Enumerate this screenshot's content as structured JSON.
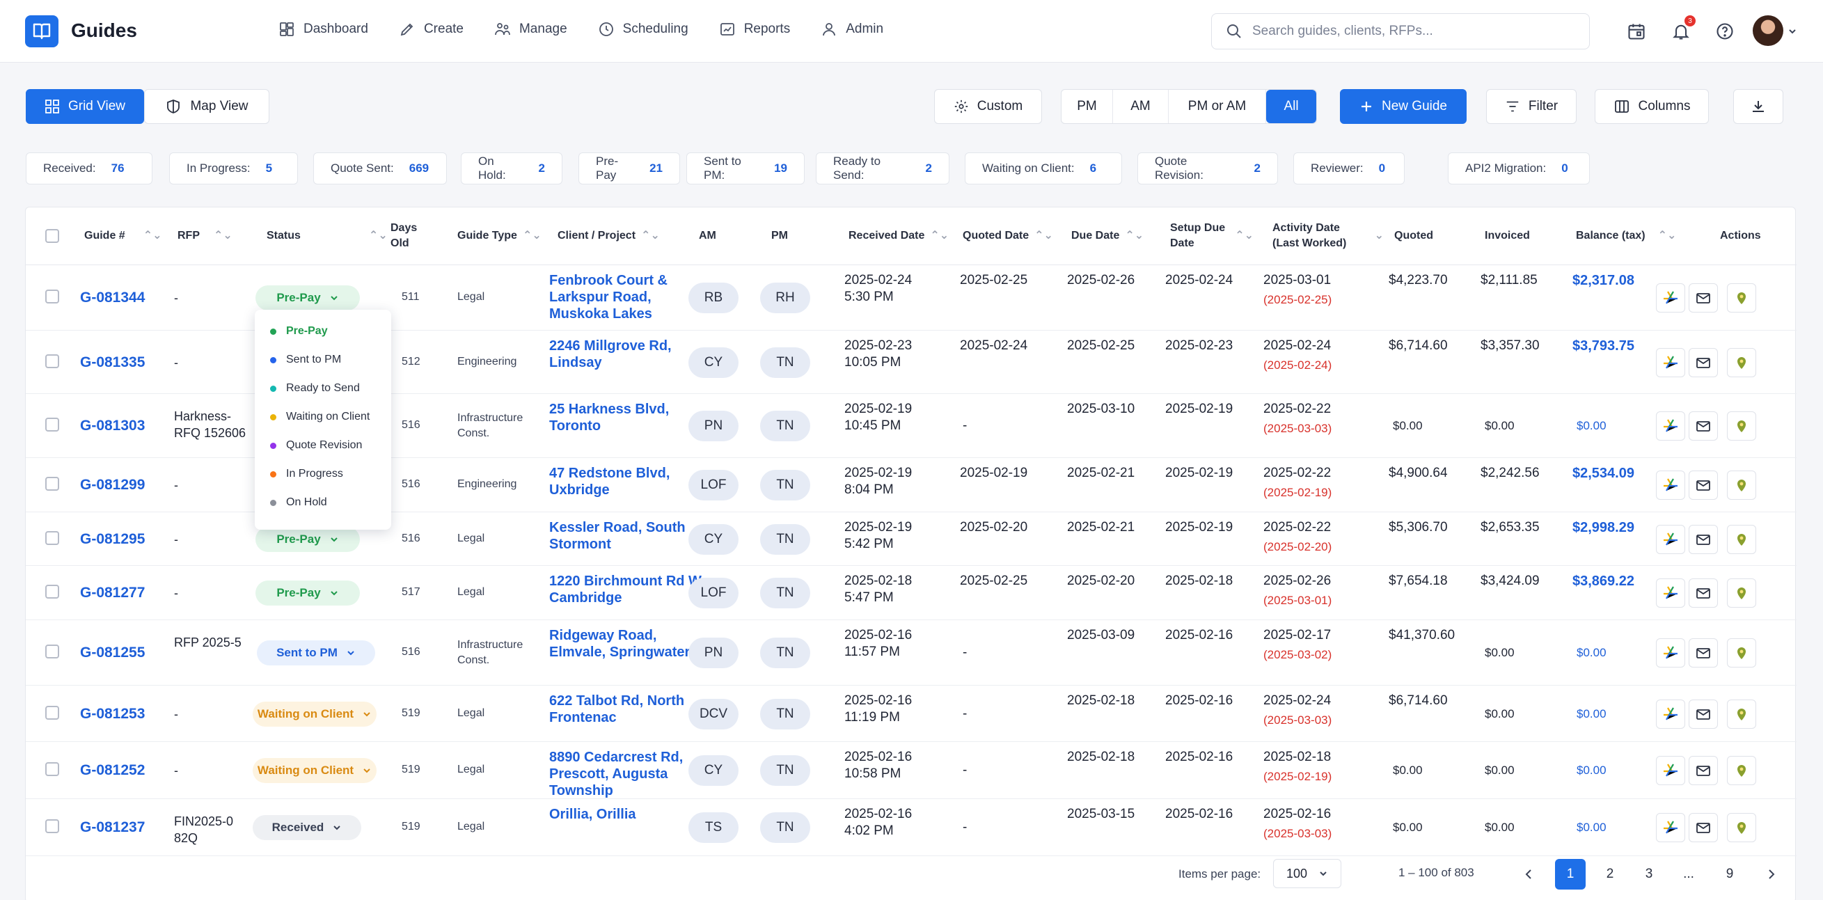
{
  "app": {
    "title": "Guides"
  },
  "nav": [
    {
      "label": "Dashboard",
      "icon": "dashboard-icon"
    },
    {
      "label": "Create",
      "icon": "pencil-icon"
    },
    {
      "label": "Manage",
      "icon": "manage-icon"
    },
    {
      "label": "Scheduling",
      "icon": "clock-icon"
    },
    {
      "label": "Reports",
      "icon": "reports-icon"
    },
    {
      "label": "Admin",
      "icon": "user-icon"
    }
  ],
  "search": {
    "placeholder": "Search guides, clients, RFPs..."
  },
  "notifications": {
    "count": "3"
  },
  "toolbar": {
    "grid_view": "Grid View",
    "map_view": "Map View",
    "custom": "Custom",
    "segments": [
      "PM",
      "AM",
      "PM or AM",
      "All"
    ],
    "active_segment": "All",
    "new_guide": "New Guide",
    "filter": "Filter",
    "columns": "Columns"
  },
  "status_counts": [
    {
      "label": "Received:",
      "count": "76"
    },
    {
      "label": "In Progress:",
      "count": "5"
    },
    {
      "label": "Quote Sent:",
      "count": "669"
    },
    {
      "label": "On Hold:",
      "count": "2"
    },
    {
      "label": "Pre-Pay",
      "count": "21"
    },
    {
      "label": "Sent to PM:",
      "count": "19"
    },
    {
      "label": "Ready to Send:",
      "count": "2"
    },
    {
      "label": "Waiting on Client:",
      "count": "6"
    },
    {
      "label": "Quote Revision:",
      "count": "2"
    },
    {
      "label": "Reviewer:",
      "count": "0"
    },
    {
      "label": "API2 Migration:",
      "count": "0"
    }
  ],
  "columns": {
    "guide": "Guide #",
    "rfp": "RFP",
    "status": "Status",
    "days_old": "Days Old",
    "guide_type": "Guide Type",
    "client": "Client / Project",
    "am": "AM",
    "pm": "PM",
    "received": "Received Date",
    "quoted_date": "Quoted Date",
    "due": "Due Date",
    "setup_due": "Setup Due Date",
    "activity": "Activity Date (Last Worked)",
    "quoted": "Quoted",
    "invoiced": "Invoiced",
    "balance": "Balance (tax)",
    "actions": "Actions"
  },
  "rows": [
    {
      "guide": "G-081344",
      "rfp": "-",
      "status": "Pre-Pay",
      "days": "511",
      "type": "Legal",
      "client": "Fenbrook Court & Larkspur Road, Muskoka Lakes",
      "am": "RB",
      "pm": "RH",
      "received": "2025-02-24",
      "received_time": "5:30 PM",
      "quoted_date": "2025-02-25",
      "due": "2025-02-26",
      "setup_due": "2025-02-24",
      "activity": "2025-03-01",
      "activity_red": "(2025-02-25)",
      "quoted": "$4,223.70",
      "invoiced": "$2,111.85",
      "balance": "$2,317.08"
    },
    {
      "guide": "G-081335",
      "rfp": "-",
      "status": "",
      "days": "512",
      "type": "Engineering",
      "client": "2246 Millgrove Rd, Lindsay",
      "am": "CY",
      "pm": "TN",
      "received": "2025-02-23",
      "received_time": "10:05 PM",
      "quoted_date": "2025-02-24",
      "due": "2025-02-25",
      "setup_due": "2025-02-23",
      "activity": "2025-02-24",
      "activity_red": "(2025-02-24)",
      "quoted": "$6,714.60",
      "invoiced": "$3,357.30",
      "balance": "$3,793.75"
    },
    {
      "guide": "G-081303",
      "rfp": "Harkness-RFQ 152606",
      "status": "",
      "days": "516",
      "type": "Infrastructure Const.",
      "client": "25 Harkness Blvd, Toronto",
      "am": "PN",
      "pm": "TN",
      "received": "2025-02-19",
      "received_time": "10:45 PM",
      "quoted_date": "-",
      "due": "2025-03-10",
      "setup_due": "2025-02-19",
      "activity": "2025-02-22",
      "activity_red": "(2025-03-03)",
      "quoted": "$0.00",
      "invoiced": "$0.00",
      "balance": "$0.00"
    },
    {
      "guide": "G-081299",
      "rfp": "-",
      "status": "",
      "days": "516",
      "type": "Engineering",
      "client": "47 Redstone Blvd, Uxbridge",
      "am": "LOF",
      "pm": "TN",
      "received": "2025-02-19",
      "received_time": "8:04 PM",
      "quoted_date": "2025-02-19",
      "due": "2025-02-21",
      "setup_due": "2025-02-19",
      "activity": "2025-02-22",
      "activity_red": "(2025-02-19)",
      "quoted": "$4,900.64",
      "invoiced": "$2,242.56",
      "balance": "$2,534.09"
    },
    {
      "guide": "G-081295",
      "rfp": "-",
      "status": "Pre-Pay",
      "days": "516",
      "type": "Legal",
      "client": "Kessler Road, South Stormont",
      "am": "CY",
      "pm": "TN",
      "received": "2025-02-19",
      "received_time": "5:42 PM",
      "quoted_date": "2025-02-20",
      "due": "2025-02-21",
      "setup_due": "2025-02-19",
      "activity": "2025-02-22",
      "activity_red": "(2025-02-20)",
      "quoted": "$5,306.70",
      "invoiced": "$2,653.35",
      "balance": "$2,998.29"
    },
    {
      "guide": "G-081277",
      "rfp": "-",
      "status": "Pre-Pay",
      "days": "517",
      "type": "Legal",
      "client": "1220 Birchmount Rd W, Cambridge",
      "am": "LOF",
      "pm": "TN",
      "received": "2025-02-18",
      "received_time": "5:47 PM",
      "quoted_date": "2025-02-25",
      "due": "2025-02-20",
      "setup_due": "2025-02-18",
      "activity": "2025-02-26",
      "activity_red": "(2025-03-01)",
      "quoted": "$7,654.18",
      "invoiced": "$3,424.09",
      "balance": "$3,869.22"
    },
    {
      "guide": "G-081255",
      "rfp": "RFP 2025-5",
      "status": "Sent to PM",
      "days": "516",
      "type": "Infrastructure Const.",
      "client": "Ridgeway Road, Elmvale, Springwater",
      "am": "PN",
      "pm": "TN",
      "received": "2025-02-16",
      "received_time": "11:57 PM",
      "quoted_date": "-",
      "due": "2025-03-09",
      "setup_due": "2025-02-16",
      "activity": "2025-02-17",
      "activity_red": "(2025-03-02)",
      "quoted": "$41,370.60",
      "invoiced": "$0.00",
      "balance": "$0.00"
    },
    {
      "guide": "G-081253",
      "rfp": "-",
      "status": "Waiting on Client",
      "days": "519",
      "type": "Legal",
      "client": "622 Talbot Rd, North Frontenac",
      "am": "DCV",
      "pm": "TN",
      "received": "2025-02-16",
      "received_time": "11:19 PM",
      "quoted_date": "-",
      "due": "2025-02-18",
      "setup_due": "2025-02-16",
      "activity": "2025-02-24",
      "activity_red": "(2025-03-03)",
      "quoted": "$6,714.60",
      "invoiced": "$0.00",
      "balance": "$0.00"
    },
    {
      "guide": "G-081252",
      "rfp": "-",
      "status": "Waiting on Client",
      "days": "519",
      "type": "Legal",
      "client": "8890 Cedarcrest Rd, Prescott, Augusta Township",
      "am": "CY",
      "pm": "TN",
      "received": "2025-02-16",
      "received_time": "10:58 PM",
      "quoted_date": "-",
      "due": "2025-02-18",
      "setup_due": "2025-02-16",
      "activity": "2025-02-18",
      "activity_red": "(2025-02-19)",
      "quoted": "$0.00",
      "invoiced": "$0.00",
      "balance": "$0.00"
    },
    {
      "guide": "G-081237",
      "rfp": "FIN2025-0 82Q",
      "status": "Received",
      "days": "519",
      "type": "Legal",
      "client": "Orillia, Orillia",
      "am": "TS",
      "pm": "TN",
      "received": "2025-02-16",
      "received_time": "4:02 PM",
      "quoted_date": "-",
      "due": "2025-03-15",
      "setup_due": "2025-02-16",
      "activity": "2025-02-16",
      "activity_red": "(2025-03-03)",
      "quoted": "$0.00",
      "invoiced": "$0.00",
      "balance": "$0.00"
    }
  ],
  "status_dropdown": [
    {
      "label": "Pre-Pay",
      "color": "#22a355"
    },
    {
      "label": "Sent to PM",
      "color": "#2563eb"
    },
    {
      "label": "Ready to Send",
      "color": "#14b8b0"
    },
    {
      "label": "Waiting on Client",
      "color": "#eab308"
    },
    {
      "label": "Quote Revision",
      "color": "#9333ea"
    },
    {
      "label": "In Progress",
      "color": "#f97316"
    },
    {
      "label": "On Hold",
      "color": "#8b8f99"
    }
  ],
  "pagination": {
    "items_per_page_label": "Items per page:",
    "items_per_page": "100",
    "range": "1 – 100 of 803",
    "pages": [
      "1",
      "2",
      "3",
      "...",
      "9"
    ],
    "current": "1"
  },
  "colors": {
    "accent": "#1e6fe8",
    "link": "#1e5fd8",
    "overdue": "#d8312b"
  }
}
